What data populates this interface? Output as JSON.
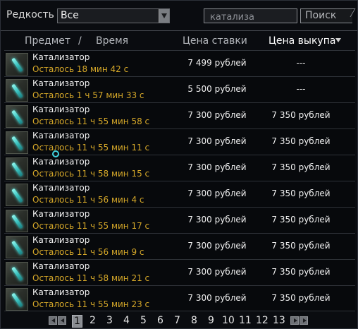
{
  "filter": {
    "rarity_label": "Редкость",
    "rarity_value": "Все",
    "search_value": "катализа",
    "search_button": "Поиск"
  },
  "header": {
    "item": "Предмет",
    "slash": "/",
    "time": "Время",
    "bid": "Цена ставки",
    "buyout": "Цена выкупа"
  },
  "rows": [
    {
      "name": "Катализатор",
      "time": "Осталось 18 мин 42 с",
      "bid": "7 499 рублей",
      "buyout": "---"
    },
    {
      "name": "Катализатор",
      "time": "Осталось 1 ч 57 мин 33 с",
      "bid": "5 500 рублей",
      "buyout": "---"
    },
    {
      "name": "Катализатор",
      "time": "Осталось 11 ч 55 мин 58 с",
      "bid": "7 300 рублей",
      "buyout": "7 350 рублей"
    },
    {
      "name": "Катализатор",
      "time": "Осталось 11 ч 55 мин 11 с",
      "bid": "7 300 рублей",
      "buyout": "7 350 рублей"
    },
    {
      "name": "Катализатор",
      "time": "Осталось 11 ч 58 мин 15 с",
      "bid": "7 300 рублей",
      "buyout": "7 350 рублей"
    },
    {
      "name": "Катализатор",
      "time": "Осталось 11 ч 56 мин 4 с",
      "bid": "7 300 рублей",
      "buyout": "7 350 рублей"
    },
    {
      "name": "Катализатор",
      "time": "Осталось 11 ч 55 мин 17 с",
      "bid": "7 300 рублей",
      "buyout": "7 350 рублей"
    },
    {
      "name": "Катализатор",
      "time": "Осталось 11 ч 56 мин 9 с",
      "bid": "7 300 рублей",
      "buyout": "7 350 рублей"
    },
    {
      "name": "Катализатор",
      "time": "Осталось 11 ч 58 мин 21 с",
      "bid": "7 300 рублей",
      "buyout": "7 350 рублей"
    },
    {
      "name": "Катализатор",
      "time": "Осталось 11 ч 55 мин 23 с",
      "bid": "7 300 рублей",
      "buyout": "7 350 рублей"
    }
  ],
  "pagination": {
    "pages": [
      "1",
      "2",
      "3",
      "4",
      "5",
      "6",
      "7",
      "8",
      "9",
      "10",
      "11",
      "12",
      "13"
    ],
    "current": "1"
  },
  "colors": {
    "time_text": "#d6a829",
    "background": "#0a0c10"
  }
}
